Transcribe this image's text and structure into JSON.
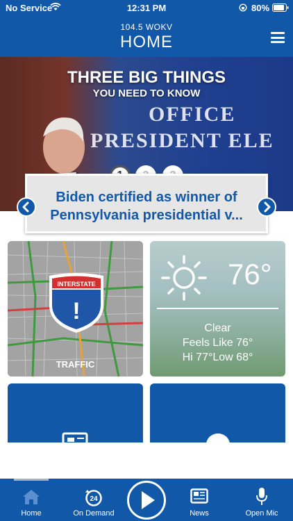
{
  "status_bar": {
    "carrier": "No Service",
    "time": "12:31 PM",
    "battery": "80%"
  },
  "header": {
    "station": "104.5 WOKV",
    "title": "HOME"
  },
  "hero": {
    "headline_line1": "THREE BIG THINGS",
    "headline_line2": "YOU NEED TO KNOW",
    "backdrop_line1": "OFFICE",
    "backdrop_line2": "PRESIDENT ELE",
    "pages": [
      "1",
      "2",
      "3"
    ],
    "active_page": 1,
    "story": "Biden certified as winner of Pennsylvania presidential v..."
  },
  "tiles": {
    "traffic": {
      "label": "TRAFFIC",
      "sign_text": "INTERSTATE",
      "sign_mark": "!"
    },
    "weather": {
      "temperature": "76°",
      "condition": "Clear",
      "feels_like": "Feels Like 76°",
      "hi_low": "Hi 77°Low 68°"
    }
  },
  "bottom_nav": {
    "items": [
      {
        "label": "Home",
        "icon": "home-icon"
      },
      {
        "label": "On Demand",
        "icon": "on-demand-24-icon"
      },
      {
        "label": "News",
        "icon": "newspaper-icon"
      },
      {
        "label": "Open Mic",
        "icon": "microphone-icon"
      }
    ],
    "play_icon": "play-icon"
  },
  "colors": {
    "brand_blue": "#1158a8",
    "story_text": "#1158a8"
  }
}
